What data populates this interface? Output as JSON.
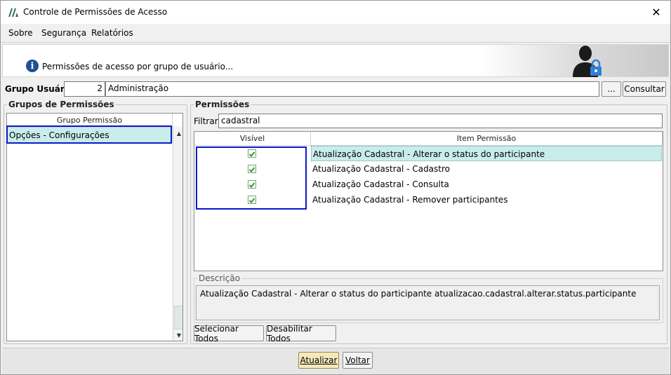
{
  "window": {
    "title": "Controle de Permissões de Acesso",
    "close_glyph": "✕"
  },
  "menu": [
    {
      "label": "Sobre"
    },
    {
      "label": "Segurança"
    },
    {
      "label": "Relatórios"
    }
  ],
  "header": {
    "text": "Permissões de acesso por grupo de usuário...",
    "info_glyph": "i",
    "icon": "user-lock-icon"
  },
  "group": {
    "label": "Grupo Usuário:",
    "code": "2",
    "name": "Administração",
    "lookup_label": "...",
    "consult_label": "Consultar"
  },
  "groups_panel": {
    "title": "Grupos de Permissões",
    "column": "Grupo Permissão",
    "items": [
      "Opções - Configurações"
    ]
  },
  "permissions_panel": {
    "title": "Permissões",
    "filter_label": "Filtrar:",
    "filter_value": "cadastral",
    "columns": [
      "Visível",
      "Item Permissão"
    ],
    "rows": [
      {
        "visible": true,
        "item": "Atualização Cadastral - Alterar o status do participante"
      },
      {
        "visible": true,
        "item": "Atualização Cadastral - Cadastro"
      },
      {
        "visible": true,
        "item": "Atualização Cadastral - Consulta"
      },
      {
        "visible": true,
        "item": "Atualização Cadastral - Remover participantes"
      }
    ]
  },
  "description": {
    "title": "Descrição",
    "text": "Atualização Cadastral - Alterar o status do participante atualizacao.cadastral.alterar.status.participante"
  },
  "actions": {
    "select_all": "Selecionar Todos",
    "disable_all": "Desabilitar Todos",
    "update": "Atualizar",
    "back": "Voltar"
  },
  "colors": {
    "selection": "#c9ecec",
    "highlight_border": "#0a19c8",
    "check": "#2e9a2e"
  }
}
